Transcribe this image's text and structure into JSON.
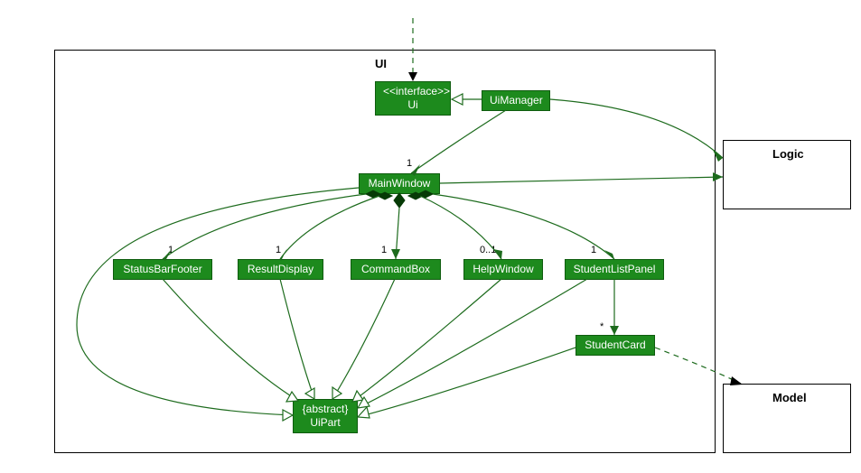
{
  "package": {
    "ui_label": "UI",
    "logic_label": "Logic",
    "model_label": "Model"
  },
  "nodes": {
    "ui_interface": {
      "stereotype": "<<interface>>",
      "name": "Ui"
    },
    "ui_manager": "UiManager",
    "main_window": "MainWindow",
    "status_bar_footer": "StatusBarFooter",
    "result_display": "ResultDisplay",
    "command_box": "CommandBox",
    "help_window": "HelpWindow",
    "student_list_panel": "StudentListPanel",
    "student_card": "StudentCard",
    "ui_part": {
      "stereotype": "{abstract}",
      "name": "UiPart"
    }
  },
  "multiplicities": {
    "main_window": "1",
    "status_bar_footer": "1",
    "result_display": "1",
    "command_box": "1",
    "help_window": "0..1",
    "student_list_panel": "1",
    "student_card": "*"
  },
  "chart_data": {
    "type": "uml_class_diagram",
    "packages": [
      {
        "name": "UI",
        "contains": [
          "Ui",
          "UiManager",
          "MainWindow",
          "StatusBarFooter",
          "ResultDisplay",
          "CommandBox",
          "HelpWindow",
          "StudentListPanel",
          "StudentCard",
          "UiPart"
        ]
      },
      {
        "name": "Logic",
        "contains": []
      },
      {
        "name": "Model",
        "contains": []
      }
    ],
    "classes": [
      {
        "name": "Ui",
        "stereotype": "interface"
      },
      {
        "name": "UiManager"
      },
      {
        "name": "MainWindow"
      },
      {
        "name": "StatusBarFooter"
      },
      {
        "name": "ResultDisplay"
      },
      {
        "name": "CommandBox"
      },
      {
        "name": "HelpWindow"
      },
      {
        "name": "StudentListPanel"
      },
      {
        "name": "StudentCard"
      },
      {
        "name": "UiPart",
        "stereotype": "abstract"
      }
    ],
    "relationships": [
      {
        "from": "(external)",
        "to": "Ui",
        "type": "dependency"
      },
      {
        "from": "UiManager",
        "to": "Ui",
        "type": "realization"
      },
      {
        "from": "UiManager",
        "to": "MainWindow",
        "type": "association",
        "to_mult": "1"
      },
      {
        "from": "UiManager",
        "to": "Logic",
        "type": "association"
      },
      {
        "from": "MainWindow",
        "to": "StatusBarFooter",
        "type": "composition",
        "to_mult": "1"
      },
      {
        "from": "MainWindow",
        "to": "ResultDisplay",
        "type": "composition",
        "to_mult": "1"
      },
      {
        "from": "MainWindow",
        "to": "CommandBox",
        "type": "composition",
        "to_mult": "1"
      },
      {
        "from": "MainWindow",
        "to": "HelpWindow",
        "type": "composition",
        "to_mult": "0..1"
      },
      {
        "from": "MainWindow",
        "to": "StudentListPanel",
        "type": "composition",
        "to_mult": "1"
      },
      {
        "from": "StudentListPanel",
        "to": "StudentCard",
        "type": "association",
        "to_mult": "*"
      },
      {
        "from": "MainWindow",
        "to": "Logic",
        "type": "association"
      },
      {
        "from": "MainWindow",
        "to": "UiPart",
        "type": "generalization"
      },
      {
        "from": "StatusBarFooter",
        "to": "UiPart",
        "type": "generalization"
      },
      {
        "from": "ResultDisplay",
        "to": "UiPart",
        "type": "generalization"
      },
      {
        "from": "CommandBox",
        "to": "UiPart",
        "type": "generalization"
      },
      {
        "from": "HelpWindow",
        "to": "UiPart",
        "type": "generalization"
      },
      {
        "from": "StudentListPanel",
        "to": "UiPart",
        "type": "generalization"
      },
      {
        "from": "StudentCard",
        "to": "UiPart",
        "type": "generalization"
      },
      {
        "from": "StudentCard",
        "to": "Model",
        "type": "dependency"
      }
    ]
  }
}
